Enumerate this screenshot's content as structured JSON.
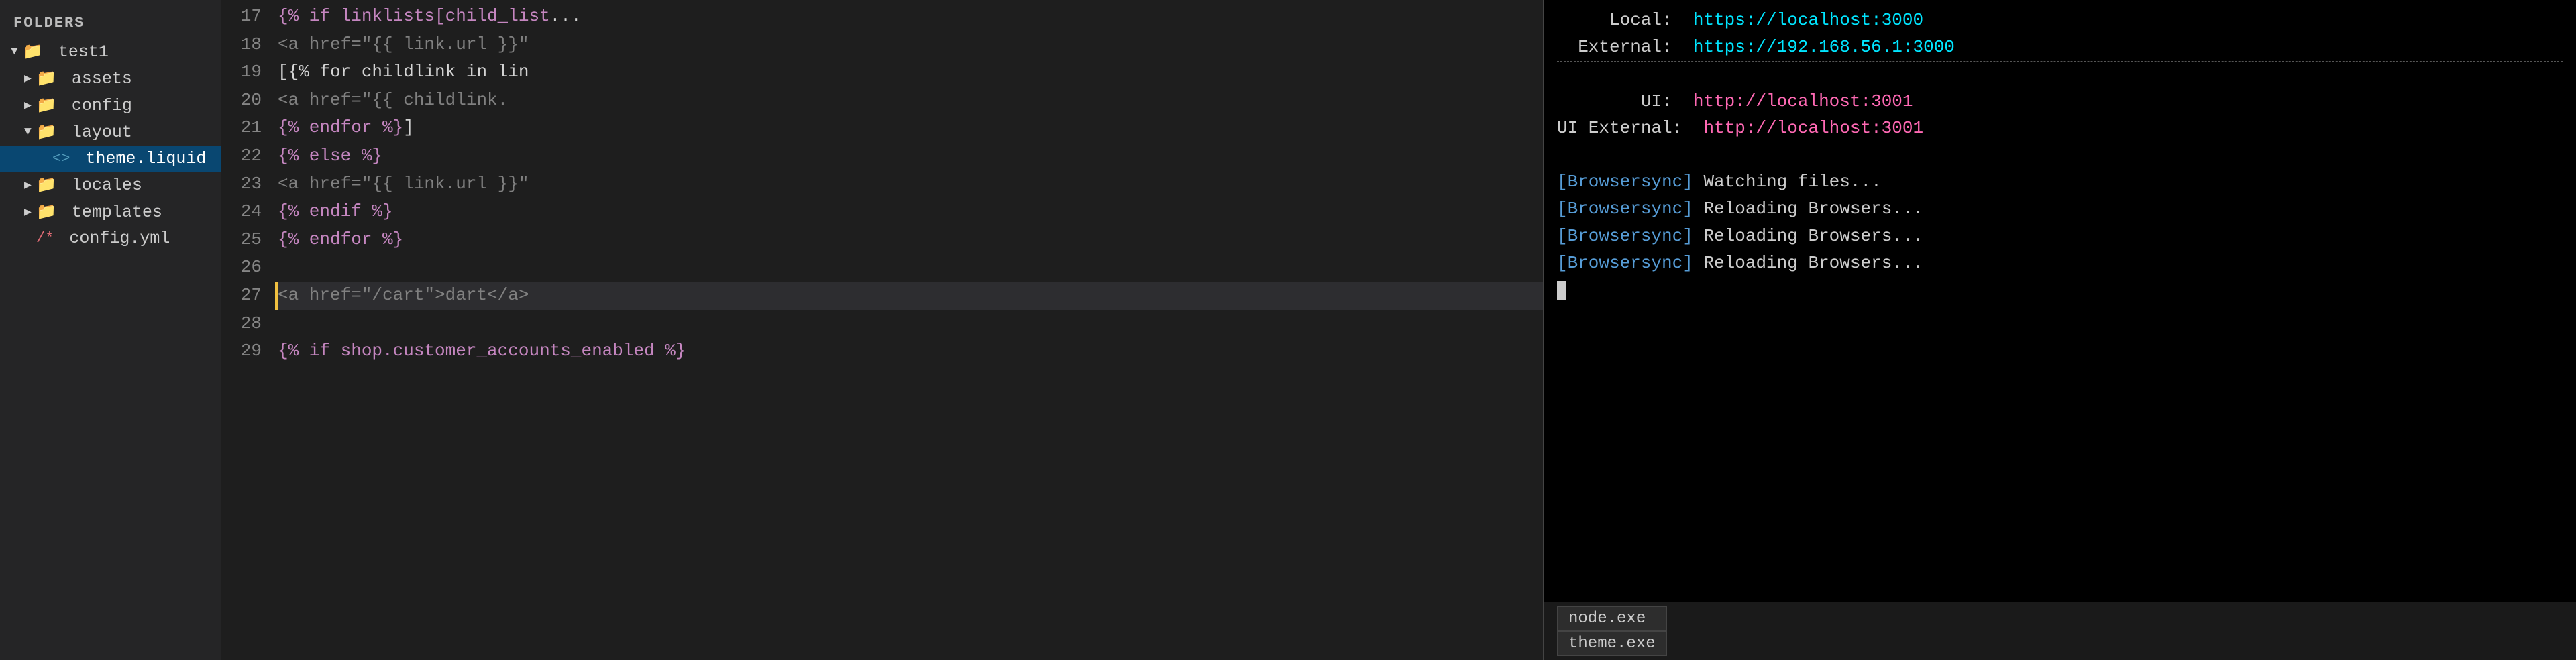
{
  "sidebar": {
    "section_title": "FOLDERS",
    "tree": [
      {
        "id": "test1",
        "label": "test1",
        "type": "folder",
        "indent": 0,
        "expanded": true,
        "arrow": "▼"
      },
      {
        "id": "assets",
        "label": "assets",
        "type": "folder",
        "indent": 1,
        "expanded": false,
        "arrow": "▶"
      },
      {
        "id": "config",
        "label": "config",
        "type": "folder",
        "indent": 1,
        "expanded": false,
        "arrow": "▶"
      },
      {
        "id": "layout",
        "label": "layout",
        "type": "folder",
        "indent": 1,
        "expanded": true,
        "arrow": "▼"
      },
      {
        "id": "theme-liquid",
        "label": "theme.liquid",
        "type": "liquid-file",
        "indent": 2,
        "selected": true
      },
      {
        "id": "locales",
        "label": "locales",
        "type": "folder",
        "indent": 1,
        "expanded": false,
        "arrow": "▶"
      },
      {
        "id": "templates",
        "label": "templates",
        "type": "folder",
        "indent": 1,
        "expanded": false,
        "arrow": "▶"
      },
      {
        "id": "config-yml",
        "label": "config.yml",
        "type": "config",
        "indent": 1
      }
    ]
  },
  "editor": {
    "lines": [
      {
        "num": 17,
        "content": [
          {
            "t": "  {% if linklists[child_list",
            "c": "kw-liquid-kw"
          },
          {
            "t": "...",
            "c": "kw-text"
          }
        ]
      },
      {
        "num": 18,
        "content": [
          {
            "t": "    <a href=\"{{ link.url }}\"",
            "c": "kw-tag"
          }
        ]
      },
      {
        "num": 19,
        "content": [
          {
            "t": "    [{%  for childlink in lin",
            "c": "kw-text"
          }
        ]
      },
      {
        "num": 20,
        "content": [
          {
            "t": "      <a href=\"{{ childlink.",
            "c": "kw-tag"
          }
        ]
      },
      {
        "num": 21,
        "content": [
          {
            "t": "    {% endfor %}",
            "c": "kw-liquid-kw"
          },
          {
            "t": "]",
            "c": "kw-text"
          }
        ]
      },
      {
        "num": 22,
        "content": [
          {
            "t": "  {% else %}",
            "c": "kw-liquid-kw"
          }
        ]
      },
      {
        "num": 23,
        "content": [
          {
            "t": "    <a href=\"{{ link.url }}\"",
            "c": "kw-tag"
          }
        ]
      },
      {
        "num": 24,
        "content": [
          {
            "t": "  {% endif %}",
            "c": "kw-liquid-kw"
          }
        ]
      },
      {
        "num": 25,
        "content": [
          {
            "t": "{% endfor %}",
            "c": "kw-liquid-kw"
          }
        ]
      },
      {
        "num": 26,
        "content": []
      },
      {
        "num": 27,
        "content": [
          {
            "t": "  <a href=\"/cart\">dart</a>",
            "c": "kw-tag"
          }
        ],
        "active": true,
        "cursor": true
      },
      {
        "num": 28,
        "content": []
      },
      {
        "num": 29,
        "content": [
          {
            "t": "  {% if shop.customer_accounts_enabled %}",
            "c": "kw-liquid-kw"
          }
        ]
      }
    ]
  },
  "terminal": {
    "lines": [
      {
        "id": "local-label",
        "text": "     Local:  ",
        "color": "term-label",
        "url": "https://localhost:3000",
        "url_color": "term-url-cyan"
      },
      {
        "id": "external-label",
        "text": "  External:  ",
        "color": "term-label",
        "url": "https://192.168.56.1:3000",
        "url_color": "term-url-cyan"
      },
      {
        "id": "dash1",
        "text": "- - - - - - - - - - - - - - - - - - -",
        "color": "term-dashes"
      },
      {
        "id": "ui-label",
        "text": "        UI:  ",
        "color": "term-label",
        "url": "http://localhost:3001",
        "url_color": "term-url-magenta"
      },
      {
        "id": "ui-ext-label",
        "text": "UI External:  ",
        "color": "term-label",
        "url": "http://localhost:3001",
        "url_color": "term-url-magenta"
      },
      {
        "id": "dash2",
        "text": "- - - - - - - - - - - - - - - - - - -",
        "color": "term-dashes"
      },
      {
        "id": "bs1",
        "text": "[Browsersync] Watching files..."
      },
      {
        "id": "bs2",
        "text": "[Browsersync] Reloading Browsers..."
      },
      {
        "id": "bs3",
        "text": "[Browsersync] Reloading Browsers..."
      },
      {
        "id": "bs4",
        "text": "[Browsersync] Reloading Browsers..."
      }
    ],
    "bottom_tabs": [
      {
        "id": "node-tab",
        "label": "node.exe"
      },
      {
        "id": "theme-tab",
        "label": "theme.exe"
      }
    ]
  }
}
